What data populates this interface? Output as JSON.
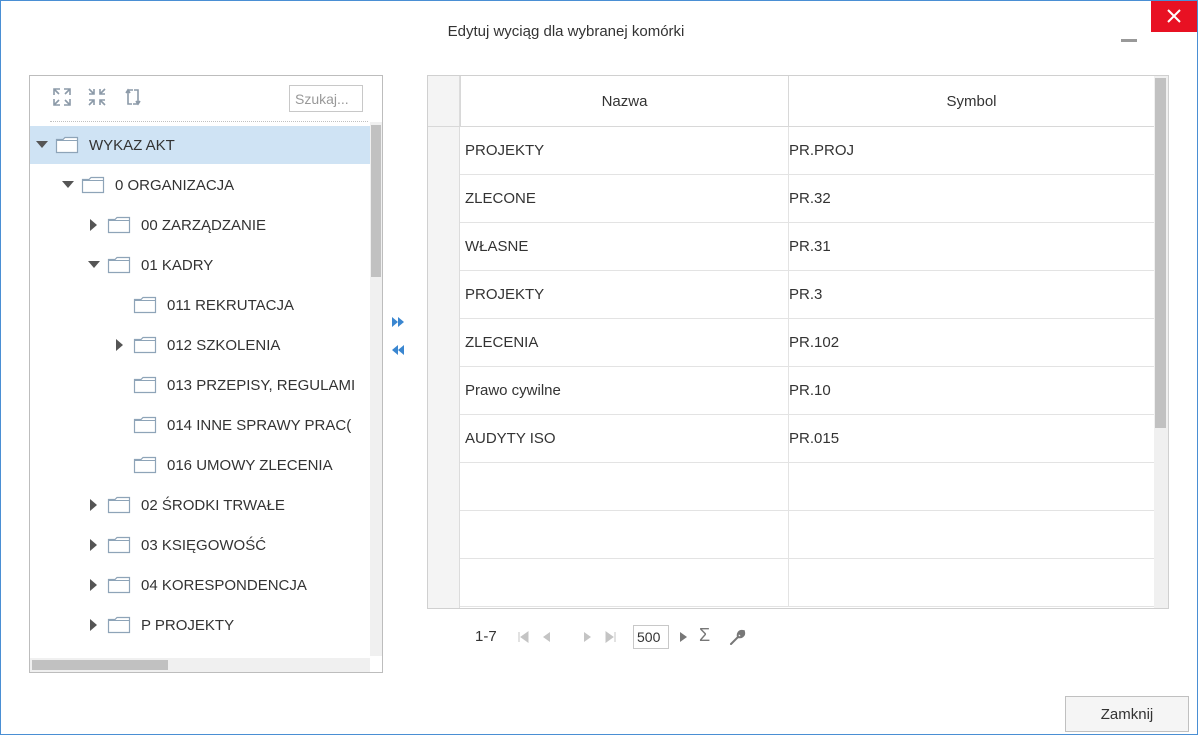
{
  "window": {
    "title": "Edytuj wyciąg dla wybranej komórki"
  },
  "tree": {
    "search_placeholder": "Szukaj...",
    "nodes": [
      {
        "label": "WYKAZ AKT",
        "level": 0,
        "state": "expanded",
        "selected": true
      },
      {
        "label": "0 ORGANIZACJA",
        "level": 1,
        "state": "expanded"
      },
      {
        "label": "00 ZARZĄDZANIE",
        "level": 2,
        "state": "collapsed"
      },
      {
        "label": "01 KADRY",
        "level": 2,
        "state": "expanded"
      },
      {
        "label": "011 REKRUTACJA",
        "level": 3,
        "state": "leaf"
      },
      {
        "label": "012 SZKOLENIA",
        "level": 3,
        "state": "collapsed"
      },
      {
        "label": "013 PRZEPISY, REGULAMI",
        "level": 3,
        "state": "leaf"
      },
      {
        "label": "014 INNE SPRAWY PRAC(",
        "level": 3,
        "state": "leaf"
      },
      {
        "label": "016 UMOWY ZLECENIA",
        "level": 3,
        "state": "leaf"
      },
      {
        "label": "02 ŚRODKI TRWAŁE",
        "level": 2,
        "state": "collapsed"
      },
      {
        "label": "03 KSIĘGOWOŚĆ",
        "level": 2,
        "state": "collapsed"
      },
      {
        "label": "04 KORESPONDENCJA",
        "level": 2,
        "state": "collapsed"
      },
      {
        "label": "P PROJEKTY",
        "level": 2,
        "state": "collapsed"
      }
    ]
  },
  "grid": {
    "columns": [
      "Nazwa",
      "Symbol"
    ],
    "rows": [
      [
        "PROJEKTY",
        "PR.PROJ"
      ],
      [
        "ZLECONE",
        "PR.32"
      ],
      [
        "WŁASNE",
        "PR.31"
      ],
      [
        "PROJEKTY",
        "PR.3"
      ],
      [
        "ZLECENIA",
        "PR.102"
      ],
      [
        "Prawo cywilne",
        "PR.10"
      ],
      [
        "AUDYTY ISO",
        "PR.015"
      ],
      [
        "",
        ""
      ],
      [
        "",
        ""
      ],
      [
        "",
        ""
      ]
    ]
  },
  "pager": {
    "range": "1-7",
    "page_size": "500"
  },
  "footer": {
    "close_label": "Zamknij"
  },
  "colors": {
    "close_bg": "#e81123",
    "selected_bg": "#cfe3f4",
    "accent": "#4a8fd4"
  }
}
